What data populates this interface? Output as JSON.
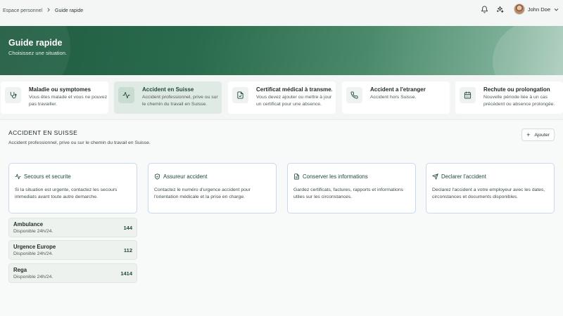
{
  "breadcrumb": {
    "root": "Espace personnel",
    "current": "Guide rapide"
  },
  "header": {
    "notifications_icon": "bell-icon",
    "sparkle_icon": "sparkles-icon",
    "user_name": "John Doe"
  },
  "hero": {
    "title": "Guide rapide",
    "subtitle": "Choisissez une situation."
  },
  "situations": [
    {
      "icon": "stethoscope-icon",
      "title": "Maladie ou symptomes",
      "desc": "Vous êtes malade et vous ne pouvez pas travailler.",
      "active": false
    },
    {
      "icon": "activity-icon",
      "title": "Accident en Suisse",
      "desc": "Accident professionnel, prive ou sur le chemin du travail en Suisse.",
      "active": true
    },
    {
      "icon": "file-check-icon",
      "title": "Certificat médical à transme...",
      "desc": "Vous devez ajouter ou mettre à jour un certificat pour une absence.",
      "active": false
    },
    {
      "icon": "phone-icon",
      "title": "Accident a l'etranger",
      "desc": "Accident hors Suisse.",
      "active": false
    },
    {
      "icon": "calendar-icon",
      "title": "Rechute ou prolongation",
      "desc": "Nouvelle période liée à un cas précédent ou absence prolongée.",
      "active": false
    }
  ],
  "panel": {
    "title": "ACCIDENT EN SUISSE",
    "subtitle": "Accident professionnel, prive ou sur le chemin du travail en Suisse.",
    "add_label": "Ajouter"
  },
  "info_cards": [
    {
      "icon": "activity-icon",
      "title": "Secours et securite",
      "text": "Si la situation est urgente, contactez les secours immediats avant toute autre demarche."
    },
    {
      "icon": "shield-check-icon",
      "title": "Assureur accident",
      "text": "Contactez le numéro d'urgence accident pour l'orientation médicale et la prise en charge."
    },
    {
      "icon": "file-text-icon",
      "title": "Conserver les informations",
      "text": "Gardez certificats, factures, rapports et informations utiles sur les circonstances."
    },
    {
      "icon": "send-icon",
      "title": "Declarer l'accident",
      "text": "Declarez l'accident a votre employeur avec les dates, circonstances et documents disponibles."
    }
  ],
  "emergency_numbers": [
    {
      "name": "Ambulance",
      "availability": "Disponible 24h/24.",
      "number": "144"
    },
    {
      "name": "Urgence Europe",
      "availability": "Disponible 24h/24.",
      "number": "112"
    },
    {
      "name": "Rega",
      "availability": "Disponible 24h/24.",
      "number": "1414"
    }
  ],
  "colors": {
    "accent": "#1f5c40",
    "card_border": "#c9d8f0",
    "active_card": "#dfeae4"
  }
}
